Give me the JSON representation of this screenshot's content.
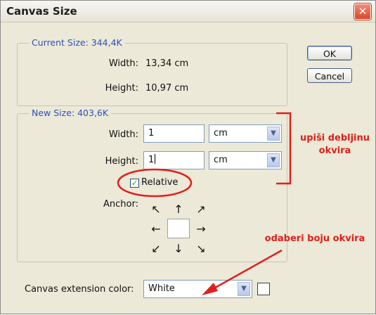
{
  "dialog": {
    "title": "Canvas Size",
    "close_symbol": "✕"
  },
  "current_size": {
    "legend": "Current Size: 344,4K",
    "width_label": "Width:",
    "width_value": "13,34 cm",
    "height_label": "Height:",
    "height_value": "10,97 cm"
  },
  "buttons": {
    "ok": "OK",
    "cancel": "Cancel"
  },
  "new_size": {
    "legend": "New Size: 403,6K",
    "width_label": "Width:",
    "width_value": "1",
    "width_unit": "cm",
    "height_label": "Height:",
    "height_value": "1",
    "height_unit": "cm",
    "relative_label": "Relative",
    "relative_checked": true,
    "anchor_label": "Anchor:"
  },
  "anchor": {
    "arrows": [
      "↖",
      "↑",
      "↗",
      "←",
      "",
      "→",
      "↙",
      "↓",
      "↘"
    ],
    "selected": "center"
  },
  "extension": {
    "label": "Canvas extension color:",
    "value": "White",
    "swatch_color": "#ffffff"
  },
  "annotations": {
    "bracket_text_line1": "upiši debljinu",
    "bracket_text_line2": "okvira",
    "arrow_text": "odaberi boju okvira",
    "color": "#e0201c"
  },
  "colors": {
    "dialog_bg": "#ece9d8",
    "legend_blue": "#2b52b8",
    "close_red": "#d9472c"
  }
}
